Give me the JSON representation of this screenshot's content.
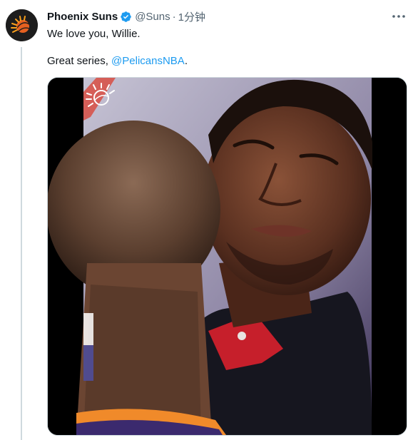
{
  "tweet": {
    "author_name": "Phoenix Suns",
    "handle": "@Suns",
    "separator": "·",
    "time": "1分钟",
    "verified": true,
    "text_line1": "We love you, Willie.",
    "text_line2_prefix": "Great series, ",
    "text_line2_mention": "@PelicansNBA",
    "text_line2_suffix": ".",
    "more_icon": "more-horizontal-icon",
    "avatar_icon": "suns-logo-icon"
  },
  "colors": {
    "mention": "#1d9bf0",
    "verified": "#1d9bf0",
    "secondary_text": "#536471"
  },
  "media": {
    "type": "video-still",
    "description_icon": "suns-watermark-icon"
  }
}
